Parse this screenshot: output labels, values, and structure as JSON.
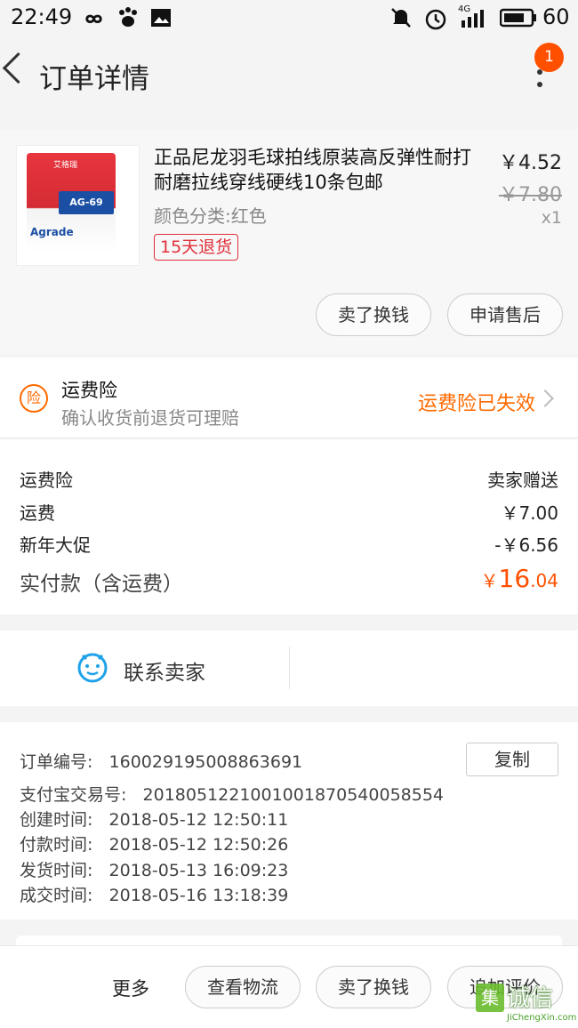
{
  "status_bar": {
    "time": "22:49",
    "battery": "60",
    "network": "4G",
    "icons": [
      "infinity-icon",
      "paw-icon",
      "image-icon",
      "mute-icon",
      "alarm-icon",
      "signal-icon",
      "battery-icon"
    ]
  },
  "header": {
    "title": "订单详情",
    "badge_count": "1"
  },
  "product": {
    "name": "正品尼龙羽毛球拍线原装高反弹性耐打耐磨拉线穿线硬线10条包邮",
    "sku": "颜色分类:红色",
    "return_tag": "15天退货",
    "price": "￥4.52",
    "original_price": "￥7.80",
    "quantity": "x1",
    "package_model": "AG-69",
    "package_brand": "Agrade",
    "package_header": "艾格瑞",
    "sell_button": "卖了换钱",
    "after_sale_button": "申请售后"
  },
  "insurance": {
    "icon_char": "险",
    "title": "运费险",
    "subtitle": "确认收货前退货可理赔",
    "status": "运费险已失效"
  },
  "summary": {
    "rows": [
      {
        "label": "运费险",
        "value": "卖家赠送"
      },
      {
        "label": "运费",
        "value": "￥7.00"
      },
      {
        "label": "新年大促",
        "value": "-￥6.56"
      }
    ],
    "total_label": "实付款（含运费）",
    "total_currency": "￥",
    "total_int": "16",
    "total_dec": ".04"
  },
  "contact": {
    "label": "联系卖家"
  },
  "order_info": {
    "rows": [
      {
        "label": "订单编号:",
        "value": "160029195008863691"
      },
      {
        "label": "支付宝交易号:",
        "value": "2018051221001001870540058554"
      },
      {
        "label": "创建时间:",
        "value": "2018-05-12 12:50:11"
      },
      {
        "label": "付款时间:",
        "value": "2018-05-12 12:50:26"
      },
      {
        "label": "发货时间:",
        "value": "2018-05-13 16:09:23"
      },
      {
        "label": "成交时间:",
        "value": "2018-05-16 13:18:39"
      }
    ],
    "copy_button": "复制"
  },
  "bottom_bar": {
    "more": "更多",
    "logistics_button": "查看物流",
    "sell_button": "卖了换钱",
    "review_button": "追加评价"
  },
  "watermark": {
    "box_char": "集",
    "text": "诚信",
    "url": "JiChengXin.com"
  },
  "colors": {
    "accent": "#ff5000",
    "insurance": "#ff6a00",
    "tag": "#e0303a",
    "contact_icon": "#1fa2e8"
  }
}
